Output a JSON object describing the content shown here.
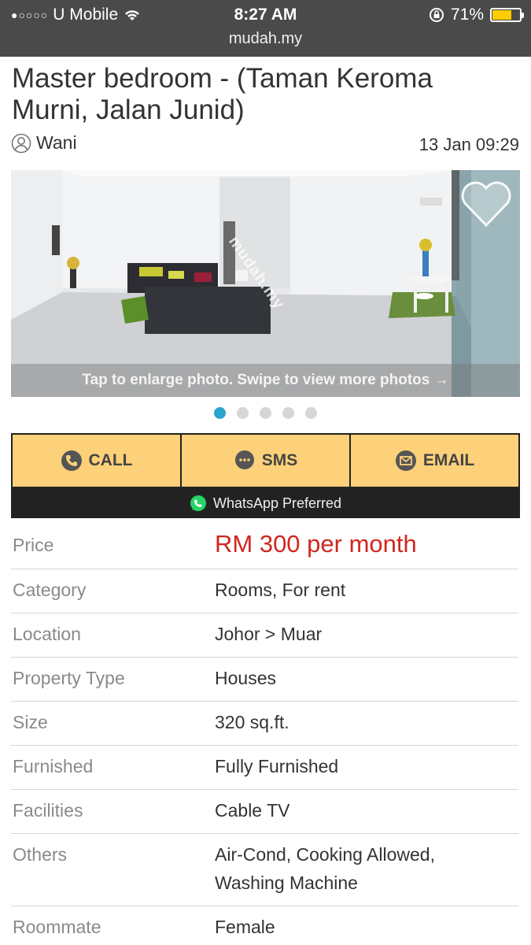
{
  "status_bar": {
    "carrier": "U Mobile",
    "time": "8:27 AM",
    "battery": "71%",
    "battery_level": 0.71,
    "url": "mudah.my"
  },
  "listing": {
    "title": "Master bedroom - (Taman Keroma Murni, Jalan Junid)",
    "author": "Wani",
    "posted": "13 Jan 09:29"
  },
  "photo": {
    "caption": "Tap to enlarge photo. Swipe to view more photos →",
    "watermark": "mudah.my",
    "total": 5,
    "current": 1
  },
  "actions": {
    "call": "CALL",
    "sms": "SMS",
    "email": "EMAIL",
    "whatsapp": "WhatsApp Preferred"
  },
  "colors": {
    "accent": "#fdd07a",
    "price": "#d0271f",
    "active_dot": "#2aa3cf",
    "whatsapp": "#25d366"
  },
  "details": [
    {
      "label": "Price",
      "value": "RM 300 per month"
    },
    {
      "label": "Category",
      "value": "Rooms, For rent"
    },
    {
      "label": "Location",
      "value": "Johor > Muar"
    },
    {
      "label": "Property Type",
      "value": "Houses"
    },
    {
      "label": "Size",
      "value": "320 sq.ft."
    },
    {
      "label": "Furnished",
      "value": "Fully Furnished"
    },
    {
      "label": "Facilities",
      "value": "Cable TV"
    },
    {
      "label": "Others",
      "value": "Air-Cond, Cooking Allowed, Washing Machine"
    },
    {
      "label": "Roommate",
      "value": "Female"
    }
  ]
}
